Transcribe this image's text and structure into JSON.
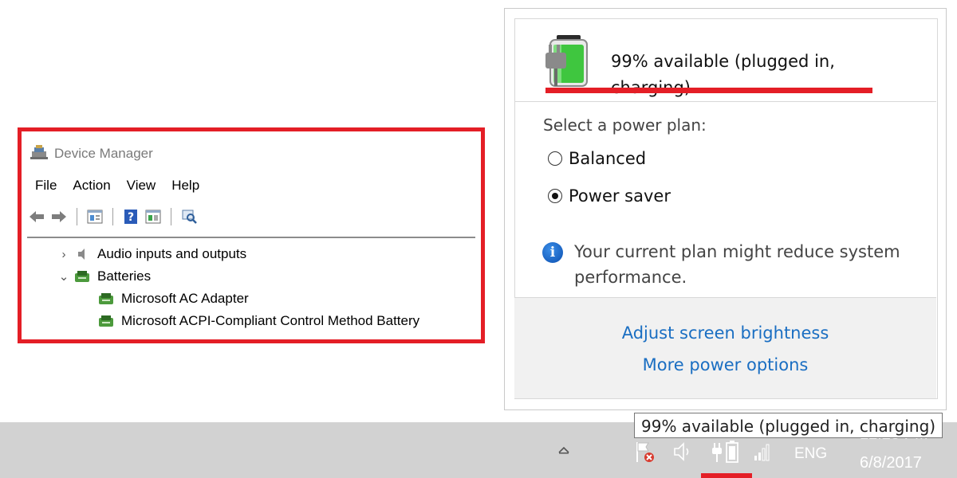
{
  "device_manager": {
    "title": "Device Manager",
    "menu": [
      "File",
      "Action",
      "View",
      "Help"
    ],
    "tree": {
      "audio": "Audio inputs and outputs",
      "batteries": "Batteries",
      "ac_adapter": "Microsoft AC Adapter",
      "acpi_battery": "Microsoft ACPI-Compliant Control Method Battery"
    },
    "highlight_color": "#e41e26"
  },
  "power_flyout": {
    "battery_status_line1": "99% available (plugged in,",
    "battery_status_line2": "charging)",
    "battery_percent": 99,
    "plan_heading": "Select a power plan:",
    "plans": [
      {
        "label": "Balanced",
        "selected": false
      },
      {
        "label": "Power saver",
        "selected": true
      }
    ],
    "info_text": "Your current plan might reduce system performance.",
    "link_brightness": "Adjust screen brightness",
    "link_more_options": "More power options",
    "link_color": "#1a6ec2"
  },
  "taskbar": {
    "tooltip": "99% available (plugged in, charging)",
    "language": "ENG",
    "time": "12:28 PM",
    "date": "6/8/2017",
    "tray_icons": [
      "chevron-up-icon",
      "flag-error-icon",
      "speaker-icon",
      "battery-plug-icon",
      "signal-icon"
    ]
  }
}
